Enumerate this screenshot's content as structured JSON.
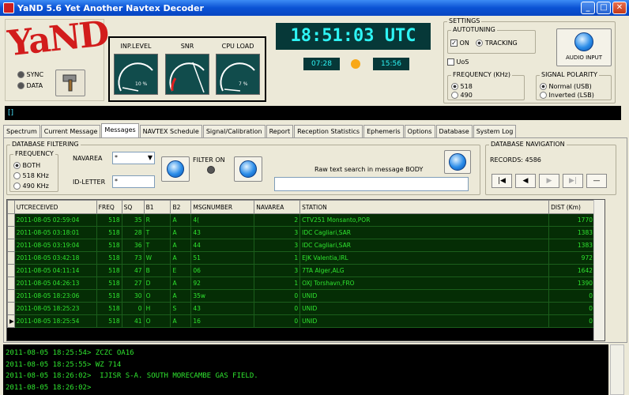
{
  "window": {
    "title": "YaND 5.6 Yet Another Navtex Decoder",
    "btn_min": "_",
    "btn_max": "□",
    "btn_close": "✕"
  },
  "logo": "YaND",
  "status": {
    "sync": "SYNC",
    "data": "DATA"
  },
  "gauges": [
    {
      "label": "INP.LEVEL",
      "value": "10 %"
    },
    {
      "label": "SNR",
      "value": ""
    },
    {
      "label": "CPU LOAD",
      "value": "7 %"
    }
  ],
  "clock": {
    "utc": "18:51:03 UTC",
    "sunrise": "07:28",
    "sunset": "15:56"
  },
  "settings": {
    "title": "SETTINGS",
    "autotuning": "AUTOTUNING",
    "on": "ON",
    "tracking": "TRACKING",
    "uos": "UoS",
    "audio_input": "AUDIO INPUT",
    "frequency_title": "FREQUENCY (KHz)",
    "freq_518": "518",
    "freq_490": "490",
    "polarity_title": "SIGNAL POLARITY",
    "normal": "Normal (USB)",
    "inverted": "Inverted (LSB)"
  },
  "message_bar": "[]",
  "tabs": [
    "Spectrum",
    "Current Message",
    "Messages",
    "NAVTEX Schedule",
    "Signal/Calibration",
    "Report",
    "Reception Statistics",
    "Ephemeris",
    "Options",
    "Database",
    "System Log"
  ],
  "active_tab": "Messages",
  "filtering": {
    "title": "DATABASE FILTERING",
    "frequency": "FREQUENCY",
    "both": "BOTH",
    "f518": "518 KHz",
    "f490": "490 KHz",
    "navarea_label": "NAVAREA",
    "navarea_value": "*",
    "idletter_label": "ID-LETTER",
    "idletter_value": "*",
    "filter_on": "FILTER ON",
    "search_label": "Raw text search in message BODY",
    "search_value": ""
  },
  "navigation": {
    "title": "DATABASE NAVIGATION",
    "records": "RECORDS: 4586",
    "first": "|◀",
    "prev": "◀",
    "next": "▶",
    "last": "▶|",
    "delete": "—"
  },
  "table": {
    "columns": [
      "UTCRECEIVED",
      "FREQ",
      "SQ",
      "B1",
      "B2",
      "MSGNUMBER",
      "NAVAREA",
      "STATION",
      "DIST (Km)"
    ],
    "rows": [
      [
        "2011-08-05 02:59:04",
        "518",
        "35",
        "R",
        "A",
        "4(",
        "2",
        "CTV251 Monsanto,POR",
        "1770"
      ],
      [
        "2011-08-05 03:18:01",
        "518",
        "28",
        "T",
        "A",
        "43",
        "3",
        "IDC Cagliari,SAR",
        "1383"
      ],
      [
        "2011-08-05 03:19:04",
        "518",
        "36",
        "T",
        "A",
        "44",
        "3",
        "IDC Cagliari,SAR",
        "1383"
      ],
      [
        "2011-08-05 03:42:18",
        "518",
        "73",
        "W",
        "A",
        "51",
        "1",
        "EJK Valentia,IRL",
        "972"
      ],
      [
        "2011-08-05 04:11:14",
        "518",
        "47",
        "B",
        "E",
        "06",
        "3",
        "7TA Alger,ALG",
        "1642"
      ],
      [
        "2011-08-05 04:26:13",
        "518",
        "27",
        "D",
        "A",
        "92",
        "1",
        "OXJ Torshavn,FRO",
        "1390"
      ],
      [
        "2011-08-05 18:23:06",
        "518",
        "30",
        "O",
        "A",
        "35w",
        "0",
        "UNID",
        "0"
      ],
      [
        "2011-08-05 18:25:23",
        "518",
        "0",
        "H",
        "S",
        "43",
        "0",
        "UNID",
        "0"
      ],
      [
        "2011-08-05 18:25:54",
        "518",
        "41",
        "O",
        "A",
        "16",
        "0",
        "UNID",
        "0"
      ]
    ]
  },
  "console": [
    "2011-08-05 18:25:54> ZCZC OA16",
    "2011-08-05 18:25:55> WZ 714",
    "2011-08-05 18:26:02>  IJISR S-A. SOUTH MORECAMBE GAS FIELD.",
    "2011-08-05 18:26:02>"
  ]
}
